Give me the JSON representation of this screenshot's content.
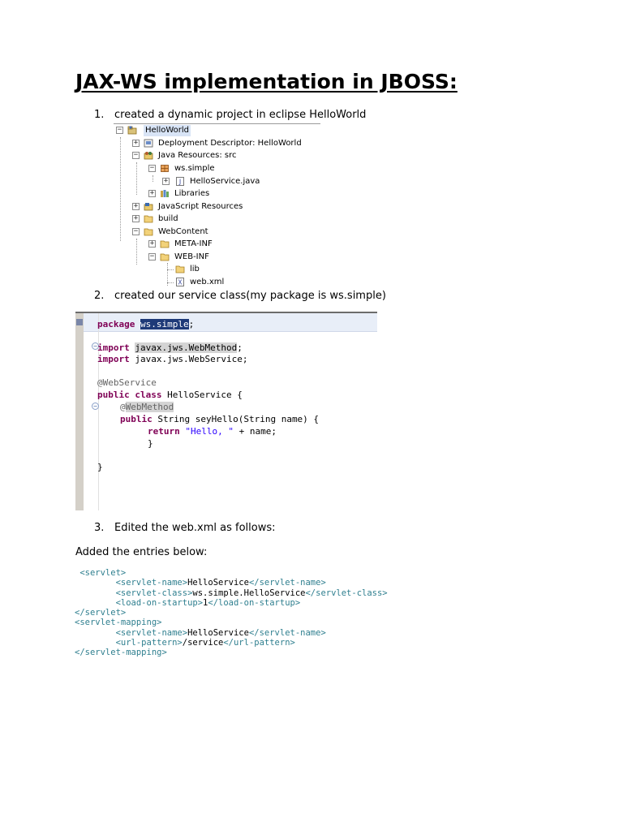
{
  "title": "JAX-WS implementation in JBOSS:",
  "steps": [
    {
      "num": "1.",
      "text": "created a dynamic project in eclipse HelloWorld"
    },
    {
      "num": "2.",
      "text": "created our service class(my package is ws.simple)"
    },
    {
      "num": "3.",
      "text": "Edited the web.xml as follows:"
    }
  ],
  "paragraph": "Added the entries below:",
  "tree": {
    "items": [
      {
        "label": "HelloWorld",
        "icon": "project-icon",
        "expander": "−"
      },
      {
        "label": "Deployment Descriptor: HelloWorld",
        "icon": "deployment-descriptor-icon",
        "expander": "+"
      },
      {
        "label": "Java Resources: src",
        "icon": "java-resources-icon",
        "expander": "−"
      },
      {
        "label": "ws.simple",
        "icon": "package-icon",
        "expander": "−"
      },
      {
        "label": "HelloService.java",
        "icon": "java-file-icon",
        "expander": "+"
      },
      {
        "label": "Libraries",
        "icon": "libraries-icon",
        "expander": "+"
      },
      {
        "label": "JavaScript Resources",
        "icon": "javascript-resources-icon",
        "expander": "+"
      },
      {
        "label": "build",
        "icon": "folder-icon",
        "expander": "+"
      },
      {
        "label": "WebContent",
        "icon": "folder-icon",
        "expander": "−"
      },
      {
        "label": "META-INF",
        "icon": "folder-icon",
        "expander": "+"
      },
      {
        "label": "WEB-INF",
        "icon": "folder-icon",
        "expander": "−"
      },
      {
        "label": "lib",
        "icon": "folder-icon",
        "expander": ""
      },
      {
        "label": "web.xml",
        "icon": "xml-file-icon",
        "expander": ""
      }
    ]
  },
  "code": {
    "package_kw": "package",
    "package_name": "ws.simple",
    "package_end": ";",
    "import_kw": "import",
    "import1": "javax.jws.WebMethod",
    "import1_end": ";",
    "import2": "javax.jws.WebService;",
    "annotation_ws": "@WebService",
    "public_class_kw": "public class",
    "class_decl": "HelloService {",
    "at": "@",
    "annotation_wm": "WebMethod",
    "public_kw": "public",
    "method_decl": "String seyHello(String name) {",
    "return_kw": "return",
    "return_str": "\"Hello, \"",
    "return_rest": "+ name;",
    "close_method": "}",
    "close_class": "}"
  },
  "xml": {
    "servlet_open": "<servlet>",
    "sn_open": "<servlet-name>",
    "sn_val": "HelloService",
    "sn_close": "</servlet-name>",
    "sc_open": "<servlet-class>",
    "sc_val": "ws.simple.HelloService",
    "sc_close": "</servlet-class>",
    "los_open": "<load-on-startup>",
    "los_val": "1",
    "los_close": "</load-on-startup>",
    "servlet_close": "</servlet>",
    "sm_open": "<servlet-mapping>",
    "sn2_open": "<servlet-name>",
    "sn2_val": "HelloService",
    "sn2_close": "</servlet-name>",
    "up_open": "<url-pattern>",
    "up_val": "/service",
    "up_close": "</url-pattern>",
    "sm_close": "</servlet-mapping>"
  },
  "colors": {
    "keyword": "#7f0055",
    "string": "#2a00ff",
    "annotation": "#646464",
    "xml_tag": "#2f7f8f"
  }
}
